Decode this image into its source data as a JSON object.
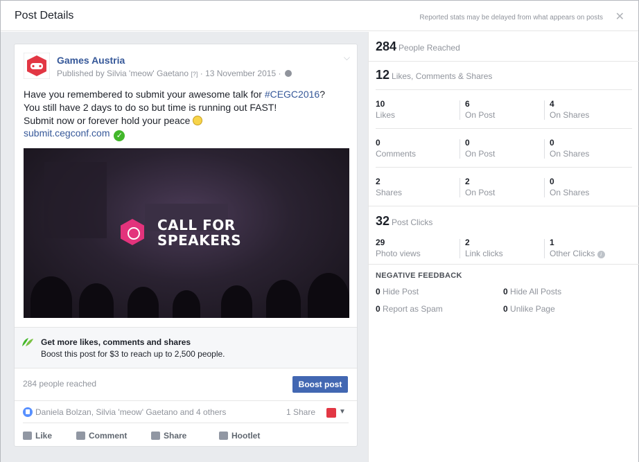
{
  "header": {
    "title": "Post Details",
    "note": "Reported stats may be delayed from what appears on posts",
    "close": "✕"
  },
  "post": {
    "page_name": "Games Austria",
    "byline_prefix": "Published by Silvia 'meow' Gaetano",
    "byline_q": "[?]",
    "byline_date": "· 13 November 2015 ·",
    "text_1": "Have you remembered to submit your awesome talk for ",
    "hashtag": "#CEGC2016",
    "text_2": "?",
    "text_3": "You still have 2 days to do so but time is running out FAST!",
    "text_4": "Submit now or forever hold your peace",
    "link": "submit.cegconf.com",
    "image_text_1": "CALL FOR",
    "image_text_2": "SPEAKERS",
    "boost_title": "Get more likes, comments and shares",
    "boost_sub": "Boost this post for $3 to reach up to 2,500 people.",
    "reached": "284 people reached",
    "boost_button": "Boost post",
    "likers": "Daniela Bolzan, Silvia 'meow' Gaetano and 4 others",
    "share_count": "1 Share",
    "actions": {
      "like": "Like",
      "comment": "Comment",
      "share": "Share",
      "hootlet": "Hootlet"
    }
  },
  "stats": {
    "reached_num": "284",
    "reached_label": "People Reached",
    "engagement_num": "12",
    "engagement_label": "Likes, Comments & Shares",
    "likes": {
      "n1": "10",
      "l1": "Likes",
      "n2": "6",
      "l2": "On Post",
      "n3": "4",
      "l3": "On Shares"
    },
    "comments": {
      "n1": "0",
      "l1": "Comments",
      "n2": "0",
      "l2": "On Post",
      "n3": "0",
      "l3": "On Shares"
    },
    "shares": {
      "n1": "2",
      "l1": "Shares",
      "n2": "2",
      "l2": "On Post",
      "n3": "0",
      "l3": "On Shares"
    },
    "clicks_num": "32",
    "clicks_label": "Post Clicks",
    "clicks": {
      "n1": "29",
      "l1": "Photo views",
      "n2": "2",
      "l2": "Link clicks",
      "n3": "1",
      "l3": "Other Clicks"
    },
    "negative_title": "NEGATIVE FEEDBACK",
    "negative": {
      "hide_post_n": "0",
      "hide_post": "Hide Post",
      "hide_all_n": "0",
      "hide_all": "Hide All Posts",
      "spam_n": "0",
      "spam": "Report as Spam",
      "unlike_n": "0",
      "unlike": "Unlike Page"
    }
  },
  "colors": {
    "link_blue": "#365899",
    "button_blue": "#4267b2",
    "muted": "#90949c",
    "brand_pink": "#e3337c"
  }
}
